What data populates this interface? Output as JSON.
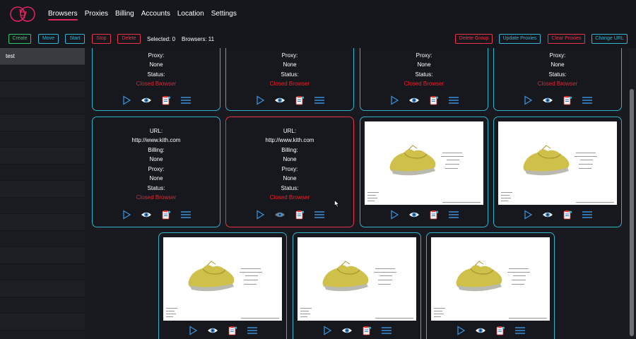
{
  "nav": {
    "items": [
      {
        "label": "Browsers",
        "active": true
      },
      {
        "label": "Proxies"
      },
      {
        "label": "Billing"
      },
      {
        "label": "Accounts"
      },
      {
        "label": "Location"
      },
      {
        "label": "Settings"
      }
    ]
  },
  "toolbar": {
    "create": "Create",
    "move": "Move",
    "start": "Start",
    "stop": "Stop",
    "delete": "Delete",
    "selected": "Selected: 0",
    "browsers": "Browsers: 11",
    "delete_group": "Delete Group",
    "update_proxies": "Update Proxies",
    "clear_proxies": "Clear Proxies",
    "change_url": "Change URL"
  },
  "sidebar": {
    "groups": [
      {
        "label": "test"
      }
    ]
  },
  "cards": {
    "labels": {
      "url": "URL:",
      "billing": "Billing:",
      "proxy": "Proxy:",
      "status": "Status:"
    },
    "values": {
      "url": "http://www.kith.com",
      "billing": "None",
      "proxy": "None",
      "status": "Closed Browser"
    }
  },
  "colors": {
    "accent_teal": "#2fb3c9",
    "accent_red": "#e8344a",
    "accent_green": "#2fc76a",
    "status_red": "#e8242e"
  },
  "icons": [
    "logo-icon",
    "play-icon",
    "eye-icon",
    "clipboard-icon",
    "menu-icon"
  ]
}
